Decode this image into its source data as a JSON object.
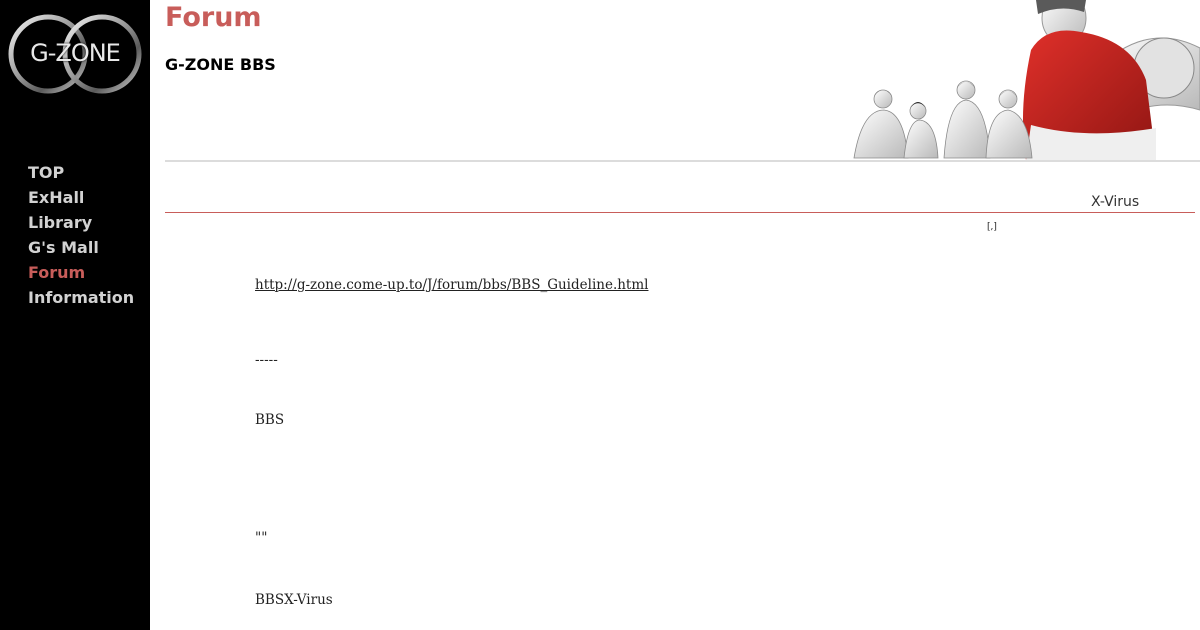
{
  "logo": {
    "text": "G-ZONE"
  },
  "nav": {
    "items": [
      {
        "label": "TOP"
      },
      {
        "label": "ExHall"
      },
      {
        "label": "Library"
      },
      {
        "label": "G's Mall"
      },
      {
        "label": "Forum"
      },
      {
        "label": "Information"
      }
    ],
    "active": "Forum"
  },
  "header": {
    "title": "Forum",
    "subtitle": "G-ZONE BBS"
  },
  "section": {
    "label": "X-Virus",
    "small_mark": "[,]"
  },
  "content": {
    "link": "http://g-zone.come-up.to/J/forum/bbs/BBS_Guideline.html",
    "dashes": "-----",
    "bbs": "BBS",
    "quotes": "\"\"",
    "bbs_xvirus": "BBSX-Virus"
  },
  "colors": {
    "sidebar_bg": "#000000",
    "accent": "#c85d5a",
    "nav_text": "#d2d2d2"
  }
}
